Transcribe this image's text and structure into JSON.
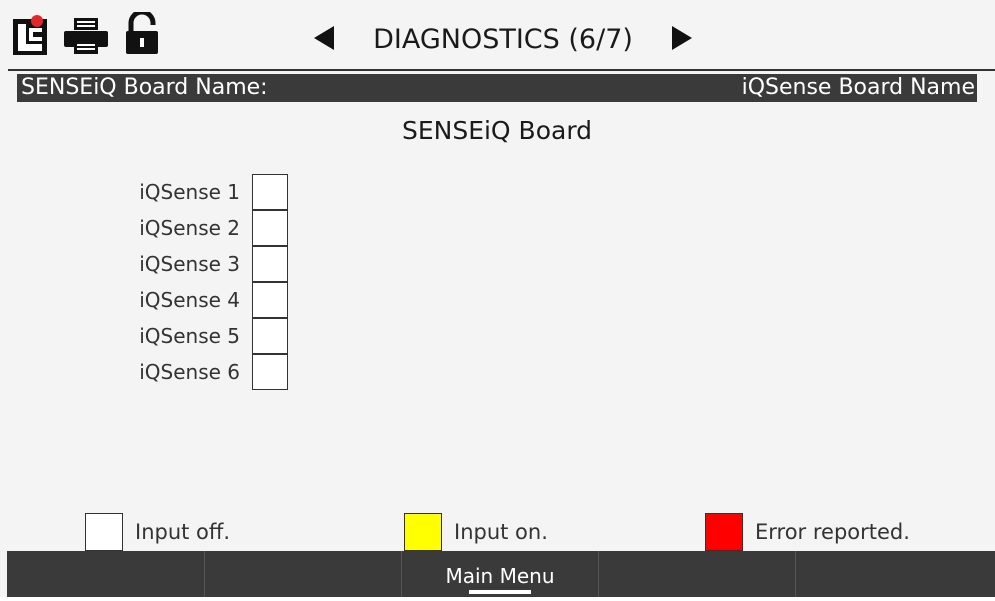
{
  "header": {
    "title": "DIAGNOSTICS (6/7)",
    "icons": [
      "lc-logo-icon",
      "printer-icon",
      "lock-open-icon",
      "arrow-left-icon",
      "arrow-right-icon"
    ]
  },
  "board_bar": {
    "label": "SENSEiQ Board Name:",
    "value": "iQSense Board Name"
  },
  "section": {
    "title": "SENSEiQ Board"
  },
  "inputs": [
    {
      "label": "iQSense 1",
      "state": "off"
    },
    {
      "label": "iQSense 2",
      "state": "off"
    },
    {
      "label": "iQSense 3",
      "state": "off"
    },
    {
      "label": "iQSense 4",
      "state": "off"
    },
    {
      "label": "iQSense 5",
      "state": "off"
    },
    {
      "label": "iQSense 6",
      "state": "off"
    }
  ],
  "legend": [
    {
      "label": "Input off.",
      "color": "#ffffff"
    },
    {
      "label": "Input on.",
      "color": "#ffff00"
    },
    {
      "label": "Error reported.",
      "color": "#ff0000"
    }
  ],
  "softkeys": [
    "",
    "",
    "Main Menu",
    "",
    ""
  ],
  "colors": {
    "bar_background": "#3a3a3a",
    "screen_background": "#f4f4f4",
    "logo_red": "#e3262c"
  }
}
